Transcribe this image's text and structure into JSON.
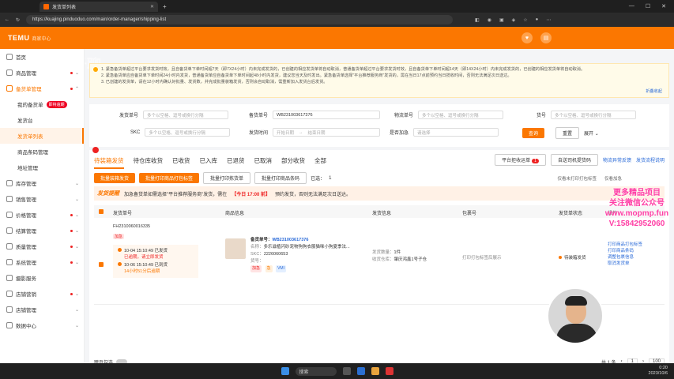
{
  "browser": {
    "tab_title": "发货单列表",
    "url": "https://kuajing.pinduoduo.com/main/order-manager/shipping-list"
  },
  "header": {
    "logo": "TEMU",
    "logo_sub": "商家中心"
  },
  "sidebar": {
    "items": [
      {
        "label": "首页"
      },
      {
        "label": "商品管理"
      },
      {
        "label": "备货单管理"
      },
      {
        "label": "库存管理"
      },
      {
        "label": "销售管理"
      },
      {
        "label": "价格管理"
      },
      {
        "label": "结算管理"
      },
      {
        "label": "质量管理"
      },
      {
        "label": "系统管理"
      },
      {
        "label": "摄影服务"
      },
      {
        "label": "店铺营销"
      },
      {
        "label": "店铺管理"
      },
      {
        "label": "数据中心"
      }
    ],
    "sub_items": [
      {
        "label": "我的备货单",
        "badge": "即将逾期"
      },
      {
        "label": "发货台"
      },
      {
        "label": "发货单列表"
      },
      {
        "label": "商品条码管理"
      },
      {
        "label": "地址管理"
      }
    ]
  },
  "notice": {
    "line1": "1. 紧急备货单超过平台要求发货时效，且自备货单下单时间超7天（即7X24小时）内未完成发货的，已创建的相应发货单将自动取消，普通备货单超过平台要求发货时效，且自备货单下单时间超14天（即14X24小时）内未完成发货的，已创建的相应发货单将自动取消。",
    "line2": "2. 紧急备货单应自备货单下单时间24小时内发货，普通备货单应自备货单下单时间起48小时内发货，建议您当天及时发出。紧急备货单选择\"平台推荐服务商\"发货的，需在当日17点前预约当日揽收时间，否则无法满足次日送达。",
    "line3": "3. 已创建的发货单，请在12小时内确认好批量、发货数，并完成批量装箱发货，否则会自动取消，需重新加入发货台后发货。",
    "fold": "折叠收起"
  },
  "filters": {
    "shipment_label": "发货单号",
    "shipment_ph": "多个以空格、逗号或换行分隔",
    "stock_label": "备货单号",
    "stock_value": "WB231003617376",
    "logistics_label": "物流单号",
    "logistics_ph": "多个以空格、逗号或换行分隔",
    "item_label": "货号",
    "item_ph": "多个以空格、逗号或换行分隔",
    "skc_label": "SKC",
    "skc_ph": "多个以空格、逗号或换行分隔",
    "time_label": "发货时间",
    "time_start": "开始日期",
    "time_sep": "→",
    "time_end": "结束日期",
    "urgent_label": "是否加急",
    "urgent_ph": "请选择",
    "query": "查询",
    "reset": "重置",
    "expand": "展开 ⌄"
  },
  "top_links": {
    "feedback": "物流异常反馈",
    "help": "发货流程说明"
  },
  "tabs": [
    {
      "label": "待装箱发货"
    },
    {
      "label": "待仓库收货"
    },
    {
      "label": "已收货"
    },
    {
      "label": "已入库"
    },
    {
      "label": "已退货"
    },
    {
      "label": "已取消"
    },
    {
      "label": "部分收货"
    },
    {
      "label": "全部"
    }
  ],
  "tab_actions": {
    "pickup_orders": "平台拒收运单",
    "pickup_count": "1",
    "print_driver": "自送司机提货码"
  },
  "actions": {
    "batch_ship": "批量装箱发货",
    "batch_print_label": "批量打印商品打包标签",
    "batch_print_picking": "批量打印拣货单",
    "batch_print_barcode": "批量打印商品条码",
    "selected_label": "已选：",
    "selected_count": "1",
    "opt1": "仅看未打印打包标签",
    "opt2": "仅看加急"
  },
  "promo": {
    "tag": "发货提醒",
    "text_a": "加急备货单如需选择\"平台推荐服务商\"发货，需在",
    "highlight": "【今日 17:00 前】",
    "text_b": "预约发货，否则无法满足次日送达。"
  },
  "table": {
    "headers": [
      "发货单号",
      "商品信息",
      "发货信息",
      "包裹号",
      "发货单状态",
      "操作"
    ],
    "row": {
      "shipment_no": "FH2310060016335",
      "urgent_tag": "加急",
      "tl1_time": "10-04 15:10:49",
      "tl1_text": "已发货",
      "tl1_sub": "已逾期，请立即发货",
      "tl2_time": "10-06 15:10:49",
      "tl2_text": "已到货",
      "tl2_sub": "14小时51分后逾期",
      "stock_label": "备货单号：",
      "stock_no": "WB231003617376",
      "name_label": "名称：",
      "name": "多乐滋植闪砂宠物狗狗衣服猫咪小狗夏季法...",
      "skc_label": "SKC：",
      "skc": "2226060653",
      "item_label": "货号：",
      "tags": [
        "加急",
        "急",
        "VMI"
      ],
      "qty_label": "发货数量：",
      "qty": "1件",
      "warehouse_label": "收货仓库：",
      "warehouse": "肇庆鸿鑫1号子仓",
      "package": "打印打包标签后展示",
      "status": "待装箱发货",
      "ops": [
        "打印商品打包标签",
        "打印商品条码",
        "调整包裹信息",
        "取消发货单"
      ]
    }
  },
  "footer": {
    "compact_label": "跨页勾选",
    "total": "共 1 条",
    "page": "1",
    "per_page": "100"
  },
  "overlay": {
    "watermark_top": "千聊",
    "wm_line1": "更多精品项目",
    "wm_line2": "关注微信公众号",
    "wm_line3": "www.mopmp.fun",
    "wm_line4": "V:15842952060"
  },
  "taskbar": {
    "search": "搜索",
    "time": "0:20",
    "date": "2023/10/6"
  }
}
